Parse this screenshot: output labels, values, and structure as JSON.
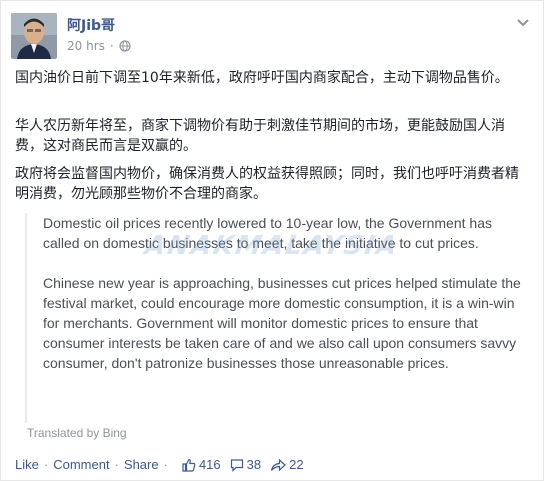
{
  "post": {
    "author": "阿Jib哥",
    "timestamp": "20 hrs",
    "separator": "·",
    "privacy_icon": "globe-icon",
    "menu_icon": "chevron-down-icon",
    "chinese_paragraphs": [
      "国内油价日前下调至10年来新低，政府呼吁国内商家配合，主动下调物品售价。",
      "华人农历新年将至，商家下调物价有助于刺激佳节期间的市场，更能鼓励国人消费，这对商民而言是双赢的。",
      "政府将会监督国内物价，确保消费人的权益获得照顾；同时，我们也呼吁消费者精明消费，勿光顾那些物价不合理的商家。"
    ],
    "translation_paragraphs": [
      "Domestic oil prices recently lowered to 10-year low, the Government has called on domestic businesses to meet, take the initiative to cut prices.",
      "Chinese new year is approaching, businesses cut prices helped stimulate the festival market, could encourage more domestic consumption, it is a win-win for merchants. Government will monitor domestic prices to ensure that consumer interests be taken care of and we also call upon consumers savvy consumer, don't patronize businesses those unreasonable prices."
    ],
    "translated_by": "Translated by Bing",
    "watermark": "ANAKMALAYSIA"
  },
  "actions": {
    "like_label": "Like",
    "comment_label": "Comment",
    "share_label": "Share",
    "dot": "·",
    "likes_count": "416",
    "comments_count": "38",
    "shares_count": "22",
    "like_icon": "thumbs-up-icon",
    "comment_icon": "speech-bubble-icon",
    "share_icon": "share-arrow-icon"
  },
  "colors": {
    "link": "#3b5998",
    "meta": "#90949c",
    "text": "#1d2129"
  }
}
